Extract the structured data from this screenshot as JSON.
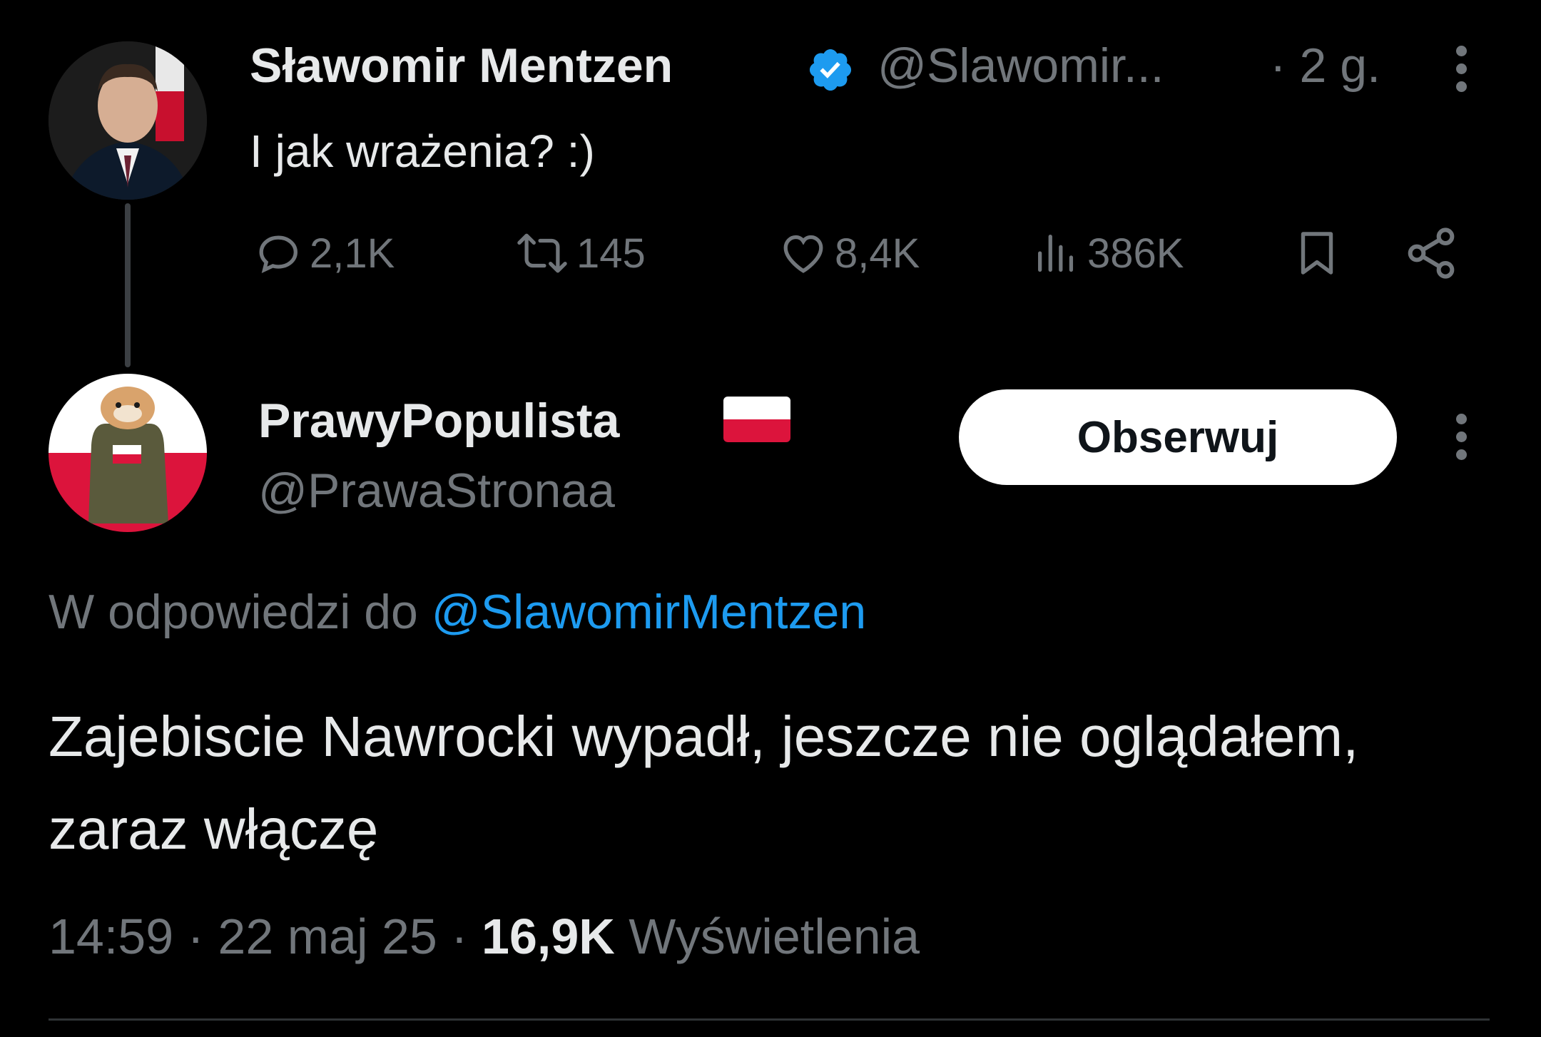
{
  "colors": {
    "background": "#000000",
    "text_primary": "#e7e9ea",
    "text_secondary": "#71767b",
    "accent_blue": "#1d9bf0",
    "button_bg": "#ffffff"
  },
  "original_tweet": {
    "author_name": "Sławomir Mentzen",
    "verified": true,
    "handle": "@Slawomir...",
    "time": "· 2 g.",
    "text": "I jak wrażenia? :)",
    "actions": {
      "replies": "2,1K",
      "reposts": "145",
      "likes": "8,4K",
      "views": "386K"
    },
    "icons": [
      "reply-icon",
      "repost-icon",
      "like-icon",
      "views-icon",
      "bookmark-icon",
      "share-icon",
      "more-icon"
    ]
  },
  "reply_tweet": {
    "author_name": "PrawyPopulista",
    "author_flag": "flag-poland-icon",
    "handle": "@PrawaStronaa",
    "follow_label": "Obserwuj",
    "reply_prefix": "W odpowiedzi do",
    "reply_mention": "@SlawomirMentzen",
    "text": "Zajebiscie Nawrocki wypadł, jeszcze nie oglądałem, zaraz włączę",
    "time": "14:59",
    "date": "22 maj 25",
    "views_count": "16,9K",
    "views_label": "Wyświetlenia"
  }
}
